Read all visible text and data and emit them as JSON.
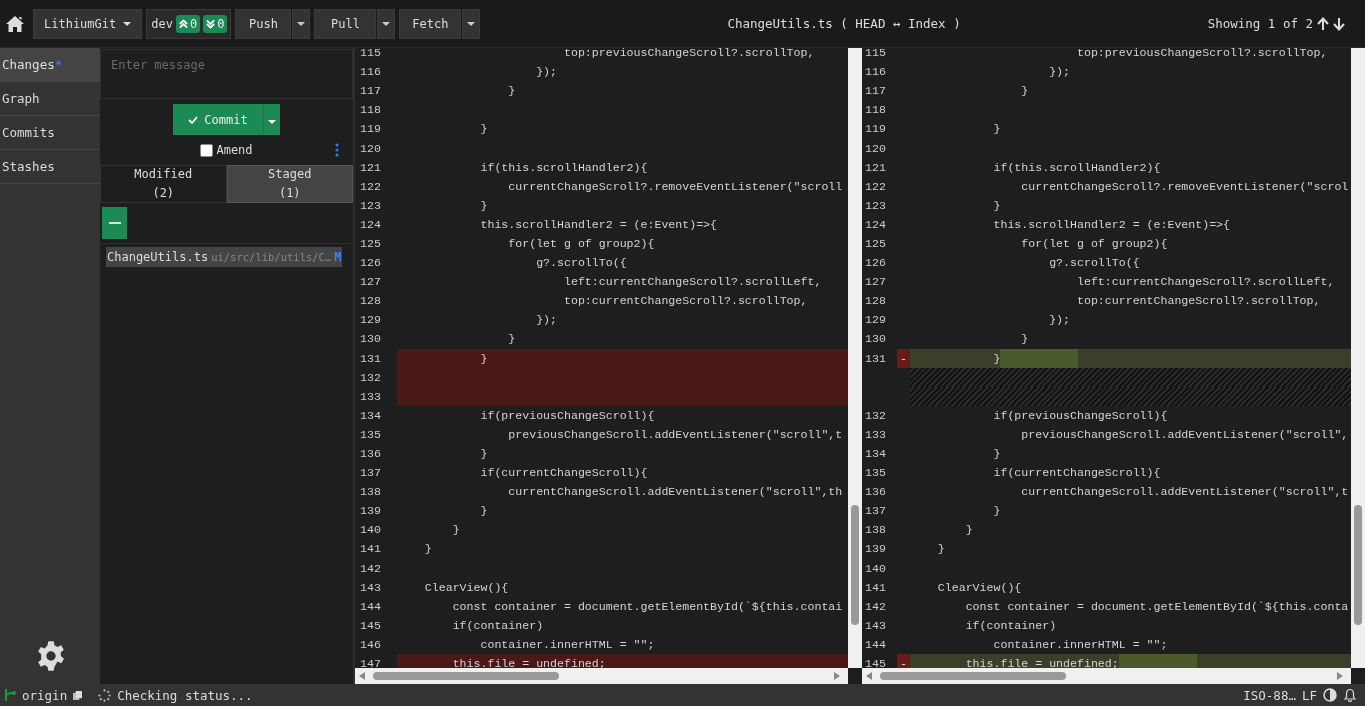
{
  "toolbar": {
    "repo": "LithiumGit",
    "branch": {
      "name": "dev",
      "ahead": "0",
      "behind": "0"
    },
    "actions": [
      {
        "label": "Push"
      },
      {
        "label": "Pull"
      },
      {
        "label": "Fetch"
      }
    ],
    "title": "ChangeUtils.ts ( HEAD ↔ Index )",
    "navigation": "Showing 1 of 2"
  },
  "sidebar": {
    "items": [
      {
        "label": "Changes",
        "badge": "*",
        "selected": true
      },
      {
        "label": "Graph",
        "selected": false
      },
      {
        "label": "Commits",
        "selected": false
      },
      {
        "label": "Stashes",
        "selected": false
      }
    ]
  },
  "commit_panel": {
    "message": {
      "placeholder": "Enter message"
    },
    "commit_button": "Commit",
    "amend": {
      "label": "Amend",
      "checked": false
    },
    "tabs": [
      {
        "label": "Modified",
        "count": "(2)",
        "selected": false
      },
      {
        "label": "Staged",
        "count": "(1)",
        "selected": true
      }
    ],
    "files": [
      {
        "name": "ChangeUtils.ts",
        "path": "ui/src/lib/utils/C…",
        "status": "M",
        "selected": true
      }
    ]
  },
  "panes": [
    {
      "kind": "base",
      "lines": [
        {
          "kind": "normal",
          "number": "115",
          "text": "                        top:previousChangeScroll?.scrollTop,"
        },
        {
          "kind": "normal",
          "number": "116",
          "text": "                    });"
        },
        {
          "kind": "normal",
          "number": "117",
          "text": "                }"
        },
        {
          "kind": "normal",
          "number": "118"
        },
        {
          "kind": "normal",
          "number": "119",
          "text": "            }"
        },
        {
          "kind": "normal",
          "number": "120"
        },
        {
          "kind": "normal",
          "number": "121",
          "text": "            if(this.scrollHandler2){"
        },
        {
          "kind": "normal",
          "number": "122",
          "text": "                currentChangeScroll?.removeEventListener(\"scroll"
        },
        {
          "kind": "normal",
          "number": "123",
          "text": "            }"
        },
        {
          "kind": "normal",
          "number": "124",
          "text": "            this.scrollHandler2 = (e:Event)=>{"
        },
        {
          "kind": "normal",
          "number": "125",
          "text": "                for(let g of group2){"
        },
        {
          "kind": "normal",
          "number": "126",
          "text": "                    g?.scrollTo({"
        },
        {
          "kind": "normal",
          "number": "127",
          "text": "                        left:currentChangeScroll?.scrollLeft,"
        },
        {
          "kind": "normal",
          "number": "128",
          "text": "                        top:currentChangeScroll?.scrollTop,"
        },
        {
          "kind": "normal",
          "number": "129",
          "text": "                    });"
        },
        {
          "kind": "normal",
          "number": "130",
          "text": "                }"
        },
        {
          "kind": "deleted",
          "number": "131",
          "text": "            }"
        },
        {
          "kind": "deleted",
          "number": "132"
        },
        {
          "kind": "deleted",
          "number": "133"
        },
        {
          "kind": "normal",
          "number": "134",
          "text": "            if(previousChangeScroll){"
        },
        {
          "kind": "normal",
          "number": "135",
          "text": "                previousChangeScroll.addEventListener(\"scroll\",t"
        },
        {
          "kind": "normal",
          "number": "136",
          "text": "            }"
        },
        {
          "kind": "normal",
          "number": "137",
          "text": "            if(currentChangeScroll){"
        },
        {
          "kind": "normal",
          "number": "138",
          "text": "                currentChangeScroll.addEventListener(\"scroll\",th"
        },
        {
          "kind": "normal",
          "number": "139",
          "text": "            }"
        },
        {
          "kind": "normal",
          "number": "140",
          "text": "        }"
        },
        {
          "kind": "normal",
          "number": "141",
          "text": "    }"
        },
        {
          "kind": "normal",
          "number": "142"
        },
        {
          "kind": "normal",
          "number": "143",
          "text": "    ClearView(){"
        },
        {
          "kind": "normal",
          "number": "144",
          "text": "        const container = document.getElementById(`${this.contai"
        },
        {
          "kind": "normal",
          "number": "145",
          "text": "        if(container)"
        },
        {
          "kind": "normal",
          "number": "146",
          "text": "            container.innerHTML = \"\";"
        },
        {
          "kind": "deleted",
          "number": "147",
          "text": "        this.file = undefined;"
        }
      ]
    },
    {
      "kind": "compare",
      "lines": [
        {
          "kind": "normal",
          "number": "115",
          "text": "                        top:previousChangeScroll?.scrollTop,"
        },
        {
          "kind": "normal",
          "number": "116",
          "text": "                    });"
        },
        {
          "kind": "normal",
          "number": "117",
          "text": "                }"
        },
        {
          "kind": "normal",
          "number": "118"
        },
        {
          "kind": "normal",
          "number": "119",
          "text": "            }"
        },
        {
          "kind": "normal",
          "number": "120"
        },
        {
          "kind": "normal",
          "number": "121",
          "text": "            if(this.scrollHandler2){"
        },
        {
          "kind": "normal",
          "number": "122",
          "text": "                currentChangeScroll?.removeEventListener(\"scrol"
        },
        {
          "kind": "normal",
          "number": "123",
          "text": "            }"
        },
        {
          "kind": "normal",
          "number": "124",
          "text": "            this.scrollHandler2 = (e:Event)=>{"
        },
        {
          "kind": "normal",
          "number": "125",
          "text": "                for(let g of group2){"
        },
        {
          "kind": "normal",
          "number": "126",
          "text": "                    g?.scrollTo({"
        },
        {
          "kind": "normal",
          "number": "127",
          "text": "                        left:currentChangeScroll?.scrollLeft,"
        },
        {
          "kind": "normal",
          "number": "128",
          "text": "                        top:currentChangeScroll?.scrollTop,"
        },
        {
          "kind": "normal",
          "number": "129",
          "text": "                    });"
        },
        {
          "kind": "normal",
          "number": "130",
          "text": "                }"
        },
        {
          "kind": "changed",
          "number": "131",
          "marker": "-",
          "text": "            }"
        },
        {
          "kind": "filler"
        },
        {
          "kind": "filler"
        },
        {
          "kind": "normal",
          "number": "132",
          "text": "            if(previousChangeScroll){"
        },
        {
          "kind": "normal",
          "number": "133",
          "text": "                previousChangeScroll.addEventListener(\"scroll\","
        },
        {
          "kind": "normal",
          "number": "134",
          "text": "            }"
        },
        {
          "kind": "normal",
          "number": "135",
          "text": "            if(currentChangeScroll){"
        },
        {
          "kind": "normal",
          "number": "136",
          "text": "                currentChangeScroll.addEventListener(\"scroll\",t"
        },
        {
          "kind": "normal",
          "number": "137",
          "text": "            }"
        },
        {
          "kind": "normal",
          "number": "138",
          "text": "        }"
        },
        {
          "kind": "normal",
          "number": "139",
          "text": "    }"
        },
        {
          "kind": "normal",
          "number": "140"
        },
        {
          "kind": "normal",
          "number": "141",
          "text": "    ClearView(){"
        },
        {
          "kind": "normal",
          "number": "142",
          "text": "        const container = document.getElementById(`${this.conta"
        },
        {
          "kind": "normal",
          "number": "143",
          "text": "        if(container)"
        },
        {
          "kind": "normal",
          "number": "144",
          "text": "            container.innerHTML = \"\";"
        },
        {
          "kind": "changed",
          "number": "145",
          "marker": "-",
          "text": "        this.file = undefined;"
        }
      ]
    }
  ],
  "status_bar": {
    "remote": "origin",
    "status": "Checking status...",
    "encoding": "ISO-88…",
    "line_ending": "LF"
  }
}
